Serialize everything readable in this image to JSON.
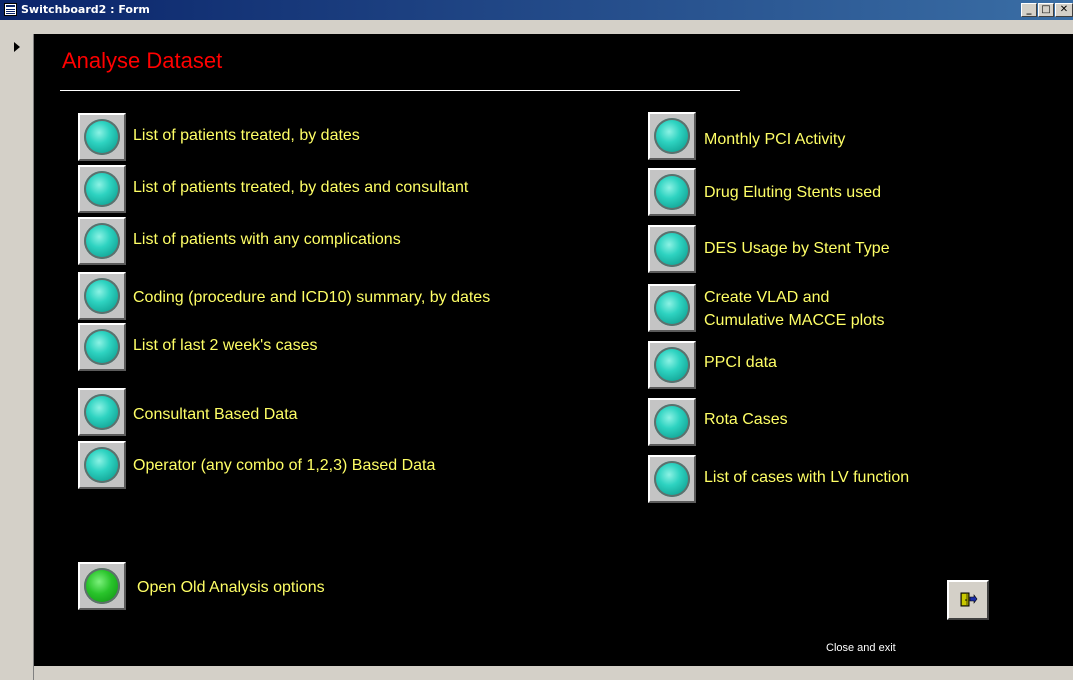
{
  "window": {
    "title": "Switchboard2 : Form",
    "controls": [
      "minimize",
      "maximize",
      "close"
    ]
  },
  "form": {
    "heading": "Analyse Dataset",
    "left_options": [
      {
        "label": "List of patients treated, by dates"
      },
      {
        "label": "List of patients treated, by dates and consultant"
      },
      {
        "label": "List of patients with any complications"
      },
      {
        "label": "Coding (procedure and ICD10) summary, by dates"
      },
      {
        "label": "List of last 2 week's cases"
      },
      {
        "label": "Consultant Based Data"
      },
      {
        "label": "Operator (any combo of 1,2,3) Based Data"
      }
    ],
    "right_options": [
      {
        "label": "Monthly PCI Activity"
      },
      {
        "label": "Drug Eluting Stents used"
      },
      {
        "label": "DES Usage by Stent Type"
      },
      {
        "label_line1": "Create VLAD and",
        "label_line2": "Cumulative MACCE plots"
      },
      {
        "label": "PPCI data"
      },
      {
        "label": "Rota Cases"
      },
      {
        "label": "List of cases with LV function"
      }
    ],
    "old_options": {
      "label": "Open Old Analysis options"
    },
    "exit": {
      "label": "Close and exit",
      "icon": "door-exit-icon"
    }
  },
  "colors": {
    "background": "#000000",
    "heading": "#ff0000",
    "option_text": "#ffff66",
    "button_teal": "#2ed3c1",
    "button_green": "#29c42b"
  }
}
